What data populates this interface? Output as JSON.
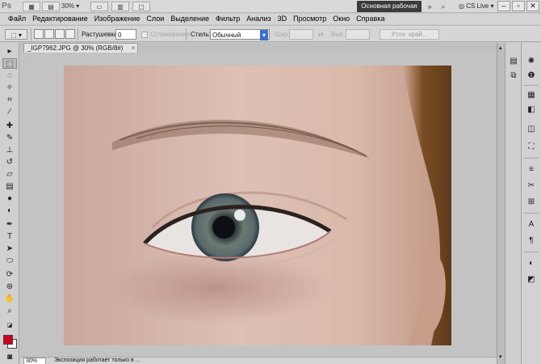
{
  "appbar": {
    "logo": "Ps",
    "zoom_value": "30%",
    "workspace_label": "Основная рабочая среда",
    "cs_live": "CS Live"
  },
  "menu": [
    "Файл",
    "Редактирование",
    "Изображение",
    "Слои",
    "Выделение",
    "Фильтр",
    "Анализ",
    "3D",
    "Просмотр",
    "Окно",
    "Справка"
  ],
  "options": {
    "feather_label": "Растушевка:",
    "feather_value": "0 пикс",
    "antialias_label": "Сглаживание",
    "style_label": "Стиль:",
    "style_value": "Обычный",
    "width_label": "Шир.:",
    "height_label": "Выс.:",
    "refine_label": "Уточ. край..."
  },
  "document": {
    "tab_title": "_IGP7962.JPG @ 30% (RGB/8#)",
    "close_glyph": "×"
  },
  "status": {
    "zoom": "30%",
    "info": "Экспозиция работает только в ..."
  },
  "colors": {
    "foreground": "#d00018",
    "background": "#ffffff",
    "workspace_button": "#3a3a3a"
  },
  "tools": [
    "move-tool",
    "marquee-tool",
    "lasso-tool",
    "quick-selection-tool",
    "crop-tool",
    "eyedropper-tool",
    "healing-brush-tool",
    "brush-tool",
    "clone-stamp-tool",
    "history-brush-tool",
    "eraser-tool",
    "gradient-tool",
    "blur-tool",
    "dodge-tool",
    "pen-tool",
    "type-tool",
    "path-selection-tool",
    "shape-tool",
    "3d-rotate-tool",
    "3d-camera-tool",
    "hand-tool",
    "zoom-tool"
  ],
  "panel_icons": [
    "color-panel-icon",
    "adjustments-panel-icon",
    "layers-panel-icon",
    "channels-panel-icon",
    "paths-panel-icon",
    "history-panel-icon",
    "brush-panel-icon",
    "clone-source-panel-icon",
    "character-panel-icon",
    "paragraph-panel-icon",
    "3d-panel-icon",
    "notes-panel-icon"
  ]
}
